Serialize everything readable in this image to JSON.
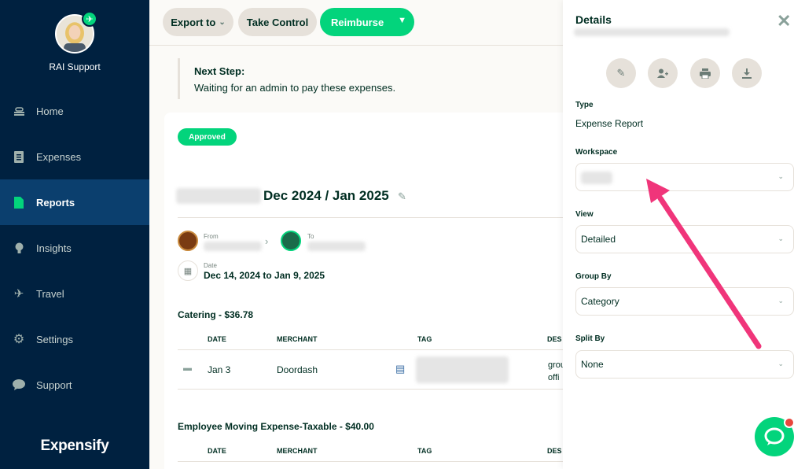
{
  "sidebar": {
    "user_name": "RAI Support",
    "brand": "Expensify",
    "items": [
      {
        "label": "Home",
        "icon": "home-icon"
      },
      {
        "label": "Expenses",
        "icon": "receipt-icon"
      },
      {
        "label": "Reports",
        "icon": "document-icon",
        "active": true
      },
      {
        "label": "Insights",
        "icon": "lightbulb-icon"
      },
      {
        "label": "Travel",
        "icon": "airplane-icon"
      },
      {
        "label": "Settings",
        "icon": "gear-icon"
      },
      {
        "label": "Support",
        "icon": "chat-bubble-icon"
      }
    ]
  },
  "toolbar": {
    "export_label": "Export to",
    "take_control_label": "Take Control",
    "reimburse_label": "Reimburse"
  },
  "next_step": {
    "title": "Next Step:",
    "text": "Waiting for an admin to pay these expenses."
  },
  "report": {
    "status": "Approved",
    "title": "Dec 2024 / Jan 2025",
    "from_label": "From",
    "to_label": "To",
    "date_label": "Date",
    "date_value": "Dec 14, 2024 to Jan 9, 2025",
    "sections": [
      {
        "title": "Catering - $36.78",
        "headers": {
          "date": "DATE",
          "merchant": "MERCHANT",
          "tag": "TAG",
          "desc": "DES"
        },
        "rows": [
          {
            "date": "Jan 3",
            "merchant": "Doordash",
            "desc_line1": "grou",
            "desc_line2": "offi"
          }
        ]
      },
      {
        "title": "Employee Moving Expense-Taxable - $40.00",
        "headers": {
          "date": "DATE",
          "merchant": "MERCHANT",
          "tag": "TAG",
          "desc": "DES"
        }
      }
    ]
  },
  "details": {
    "title": "Details",
    "type_label": "Type",
    "type_value": "Expense Report",
    "workspace_label": "Workspace",
    "view_label": "View",
    "view_value": "Detailed",
    "group_by_label": "Group By",
    "group_by_value": "Category",
    "split_by_label": "Split By",
    "split_by_value": "None"
  },
  "colors": {
    "sidebar_bg": "#002140",
    "active_nav": "#0b3f6e",
    "accent_green": "#03d47c",
    "arrow_pink": "#f0357a"
  }
}
